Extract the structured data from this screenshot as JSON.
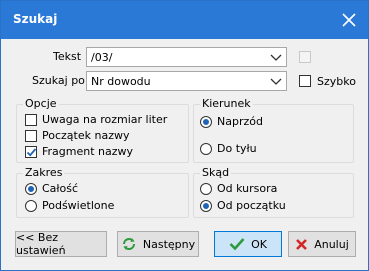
{
  "window": {
    "title": "Szukaj"
  },
  "search": {
    "text_label": "Tekst",
    "text_value": "/03/",
    "field_label": "Szukaj po",
    "field_value": "Nr dowodu",
    "quick_label": "Szybko"
  },
  "options": {
    "title": "Opcje",
    "items": [
      {
        "label": "Uwaga na rozmiar liter",
        "checked": false
      },
      {
        "label": "Początek nazwy",
        "checked": false
      },
      {
        "label": "Fragment nazwy",
        "checked": true
      }
    ]
  },
  "direction": {
    "title": "Kierunek",
    "items": [
      {
        "label": "Naprzód",
        "checked": true
      },
      {
        "label": "Do tyłu",
        "checked": false
      }
    ]
  },
  "range": {
    "title": "Zakres",
    "items": [
      {
        "label": "Całość",
        "checked": true
      },
      {
        "label": "Podświetlone",
        "checked": false
      }
    ]
  },
  "from": {
    "title": "Skąd",
    "items": [
      {
        "label": "Od kursora",
        "checked": false
      },
      {
        "label": "Od początku",
        "checked": true
      }
    ]
  },
  "buttons": {
    "reset": "<< Bez ustawień",
    "next": "Następny",
    "ok": "OK",
    "cancel": "Anuluj"
  }
}
